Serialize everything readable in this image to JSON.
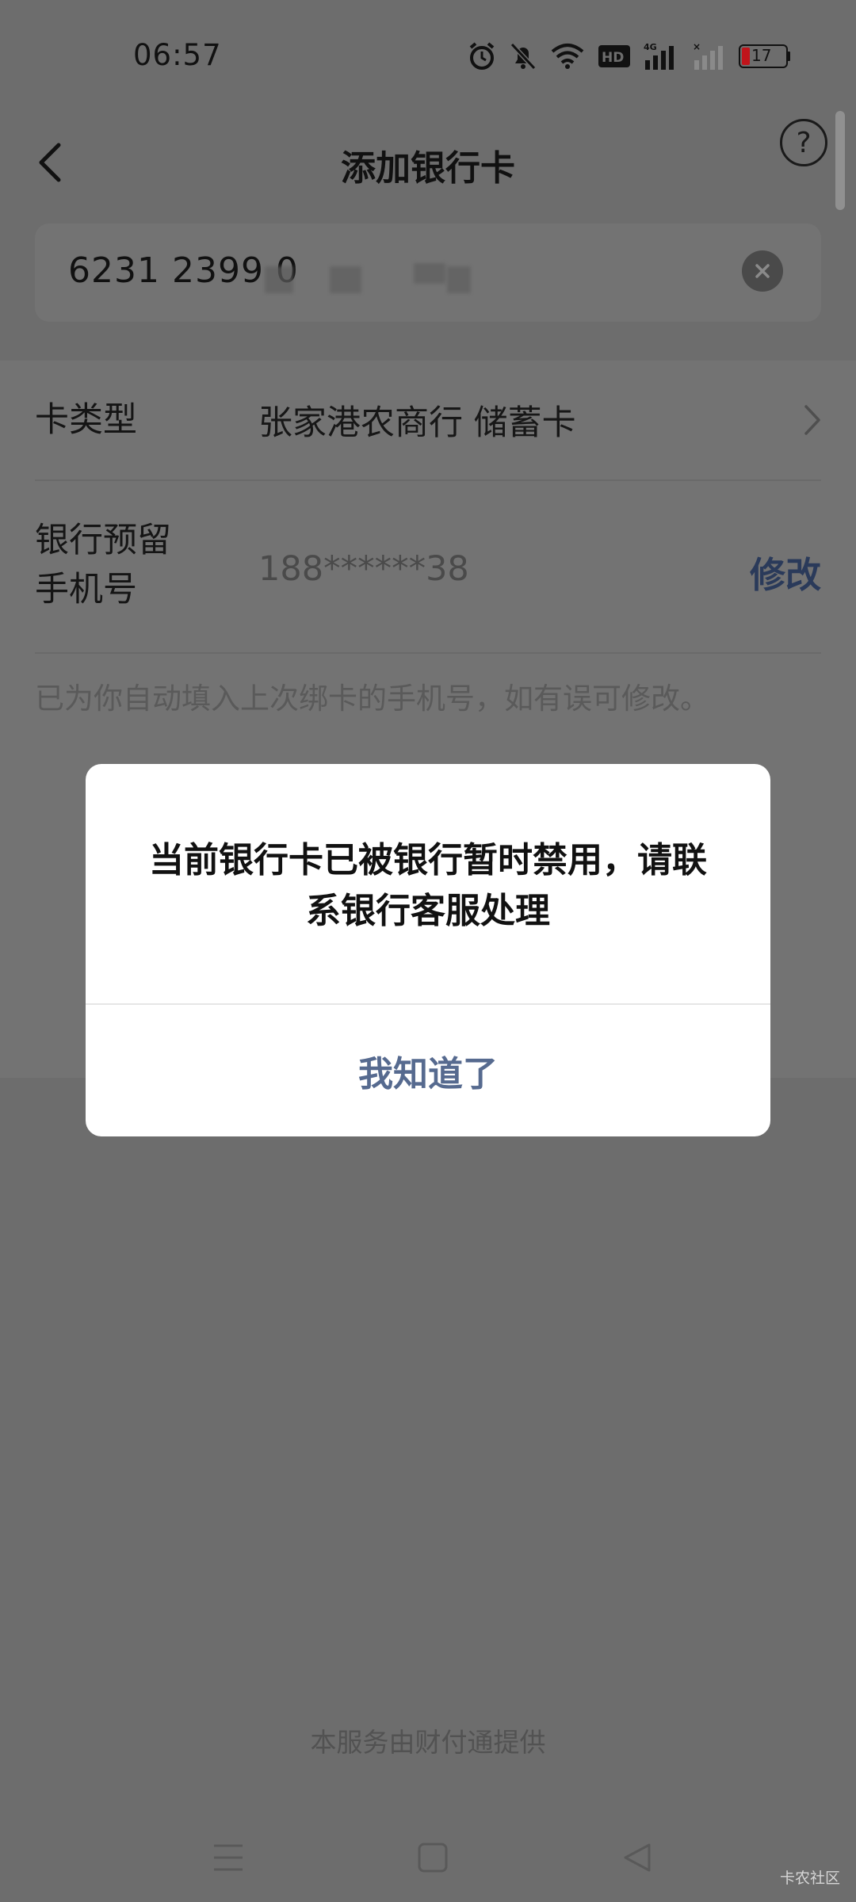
{
  "status_bar": {
    "time": "06:57",
    "battery": "17"
  },
  "nav": {
    "title": "添加银行卡",
    "help_icon": "help-icon",
    "back_icon": "back-icon"
  },
  "card_input": {
    "value": "6231 2399 0"
  },
  "rows": {
    "card_type": {
      "label": "卡类型",
      "value": "张家港农商行 储蓄卡"
    },
    "phone": {
      "label_line1": "银行预留",
      "label_line2": "手机号",
      "value": "188******38",
      "edit_label": "修改"
    }
  },
  "hint": "已为你自动填入上次绑卡的手机号，如有误可修改。",
  "dialog": {
    "message_line1": "当前银行卡已被银行暂时禁用，请联",
    "message_line2": "系银行客服处理",
    "button_label": "我知道了"
  },
  "footer": "本服务由财付通提供",
  "watermark": "卡农社区",
  "colors": {
    "overlay_bg": "#6d6d6d",
    "dialog_bg": "#ffffff",
    "dialog_button": "#566a8f",
    "edit_link": "#2a3a5a"
  }
}
